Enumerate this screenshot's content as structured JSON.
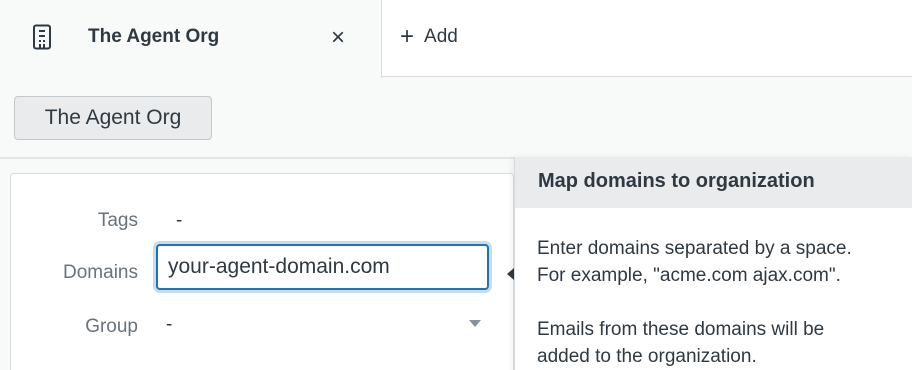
{
  "tab": {
    "label": "The Agent Org",
    "icon": "building-icon",
    "close_glyph": "×"
  },
  "add_tab": {
    "icon": "plus-icon",
    "glyph": "+",
    "label": "Add"
  },
  "header": {
    "org_name": "The Agent Org"
  },
  "properties": {
    "tags": {
      "label": "Tags",
      "value": "-"
    },
    "domains": {
      "label": "Domains",
      "value": "your-agent-domain.com"
    },
    "group": {
      "label": "Group",
      "value": "-"
    }
  },
  "help": {
    "title": "Map domains to organization",
    "line1": "Enter domains separated by a space.",
    "line2": "For example, \"acme.com ajax.com\".",
    "line3": "Emails from these domains will be",
    "line4": "added to the organization."
  },
  "colors": {
    "focus": "#1f73b7",
    "text": "#2f3941",
    "muted": "#68737d",
    "panel_header": "#e9ebed"
  }
}
